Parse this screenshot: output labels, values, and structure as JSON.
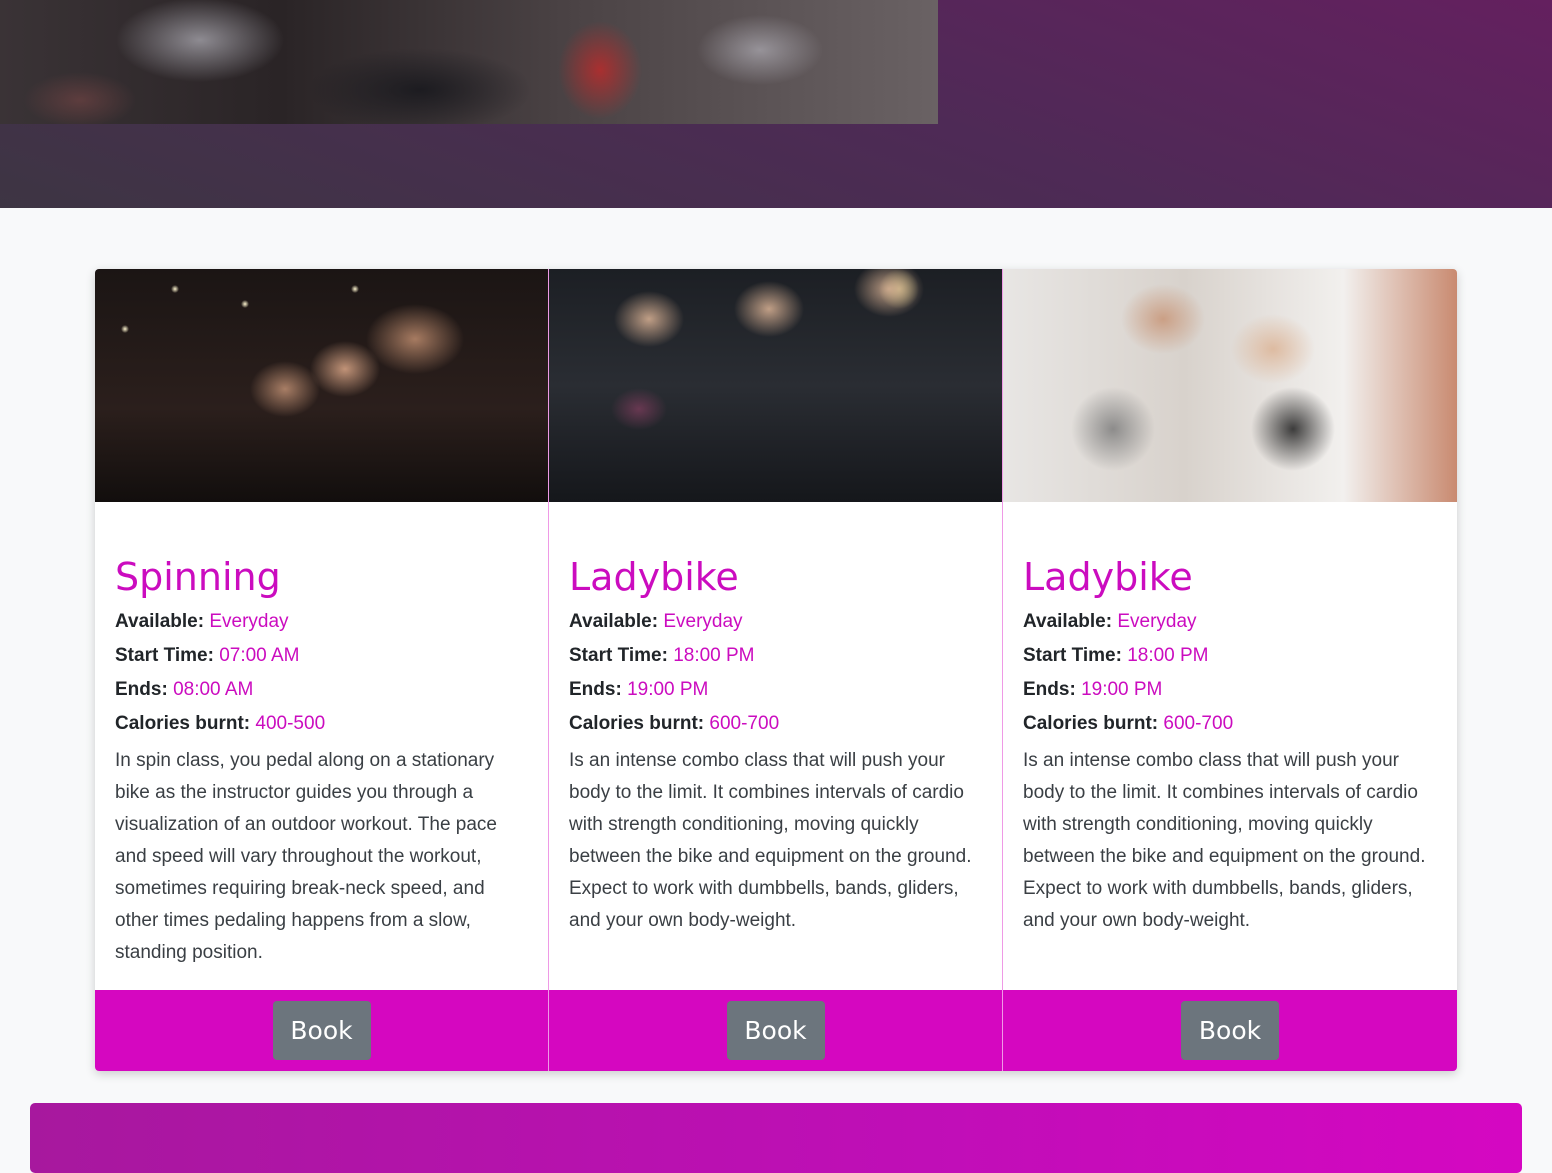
{
  "classes": [
    {
      "title": "Spinning",
      "available_label": "Available:",
      "available": "Everyday",
      "start_label": "Start Time:",
      "start": "07:00 AM",
      "ends_label": "Ends:",
      "ends": "08:00 AM",
      "calories_label": "Calories burnt:",
      "calories": "400-500",
      "description": "In spin class, you pedal along on a stationary bike as the instructor guides you through a visualization of an outdoor workout. The pace and speed will vary throughout the workout, sometimes requiring break-neck speed, and other times pedaling happens from a slow, standing position.",
      "button_label": "Book"
    },
    {
      "title": "Ladybike",
      "available_label": "Available:",
      "available": "Everyday",
      "start_label": "Start Time:",
      "start": "18:00 PM",
      "ends_label": "Ends:",
      "ends": "19:00 PM",
      "calories_label": "Calories burnt:",
      "calories": "600-700",
      "description": "Is an intense combo class that will push your body to the limit. It combines intervals of cardio with strength conditioning, moving quickly between the bike and equipment on the ground. Expect to work with dumbbells, bands, gliders, and your own body-weight.",
      "button_label": "Book"
    },
    {
      "title": "Ladybike",
      "available_label": "Available:",
      "available": "Everyday",
      "start_label": "Start Time:",
      "start": "18:00 PM",
      "ends_label": "Ends:",
      "ends": "19:00 PM",
      "calories_label": "Calories burnt:",
      "calories": "600-700",
      "description": "Is an intense combo class that will push your body to the limit. It combines intervals of cardio with strength conditioning, moving quickly between the bike and equipment on the ground. Expect to work with dumbbells, bands, gliders, and your own body-weight.",
      "button_label": "Book"
    }
  ],
  "colors": {
    "accent": "#cb0cbf",
    "footer": "#d507c0",
    "button": "#6c757d",
    "hero_top": "#64205f",
    "hero_bottom": "#3d3543"
  }
}
